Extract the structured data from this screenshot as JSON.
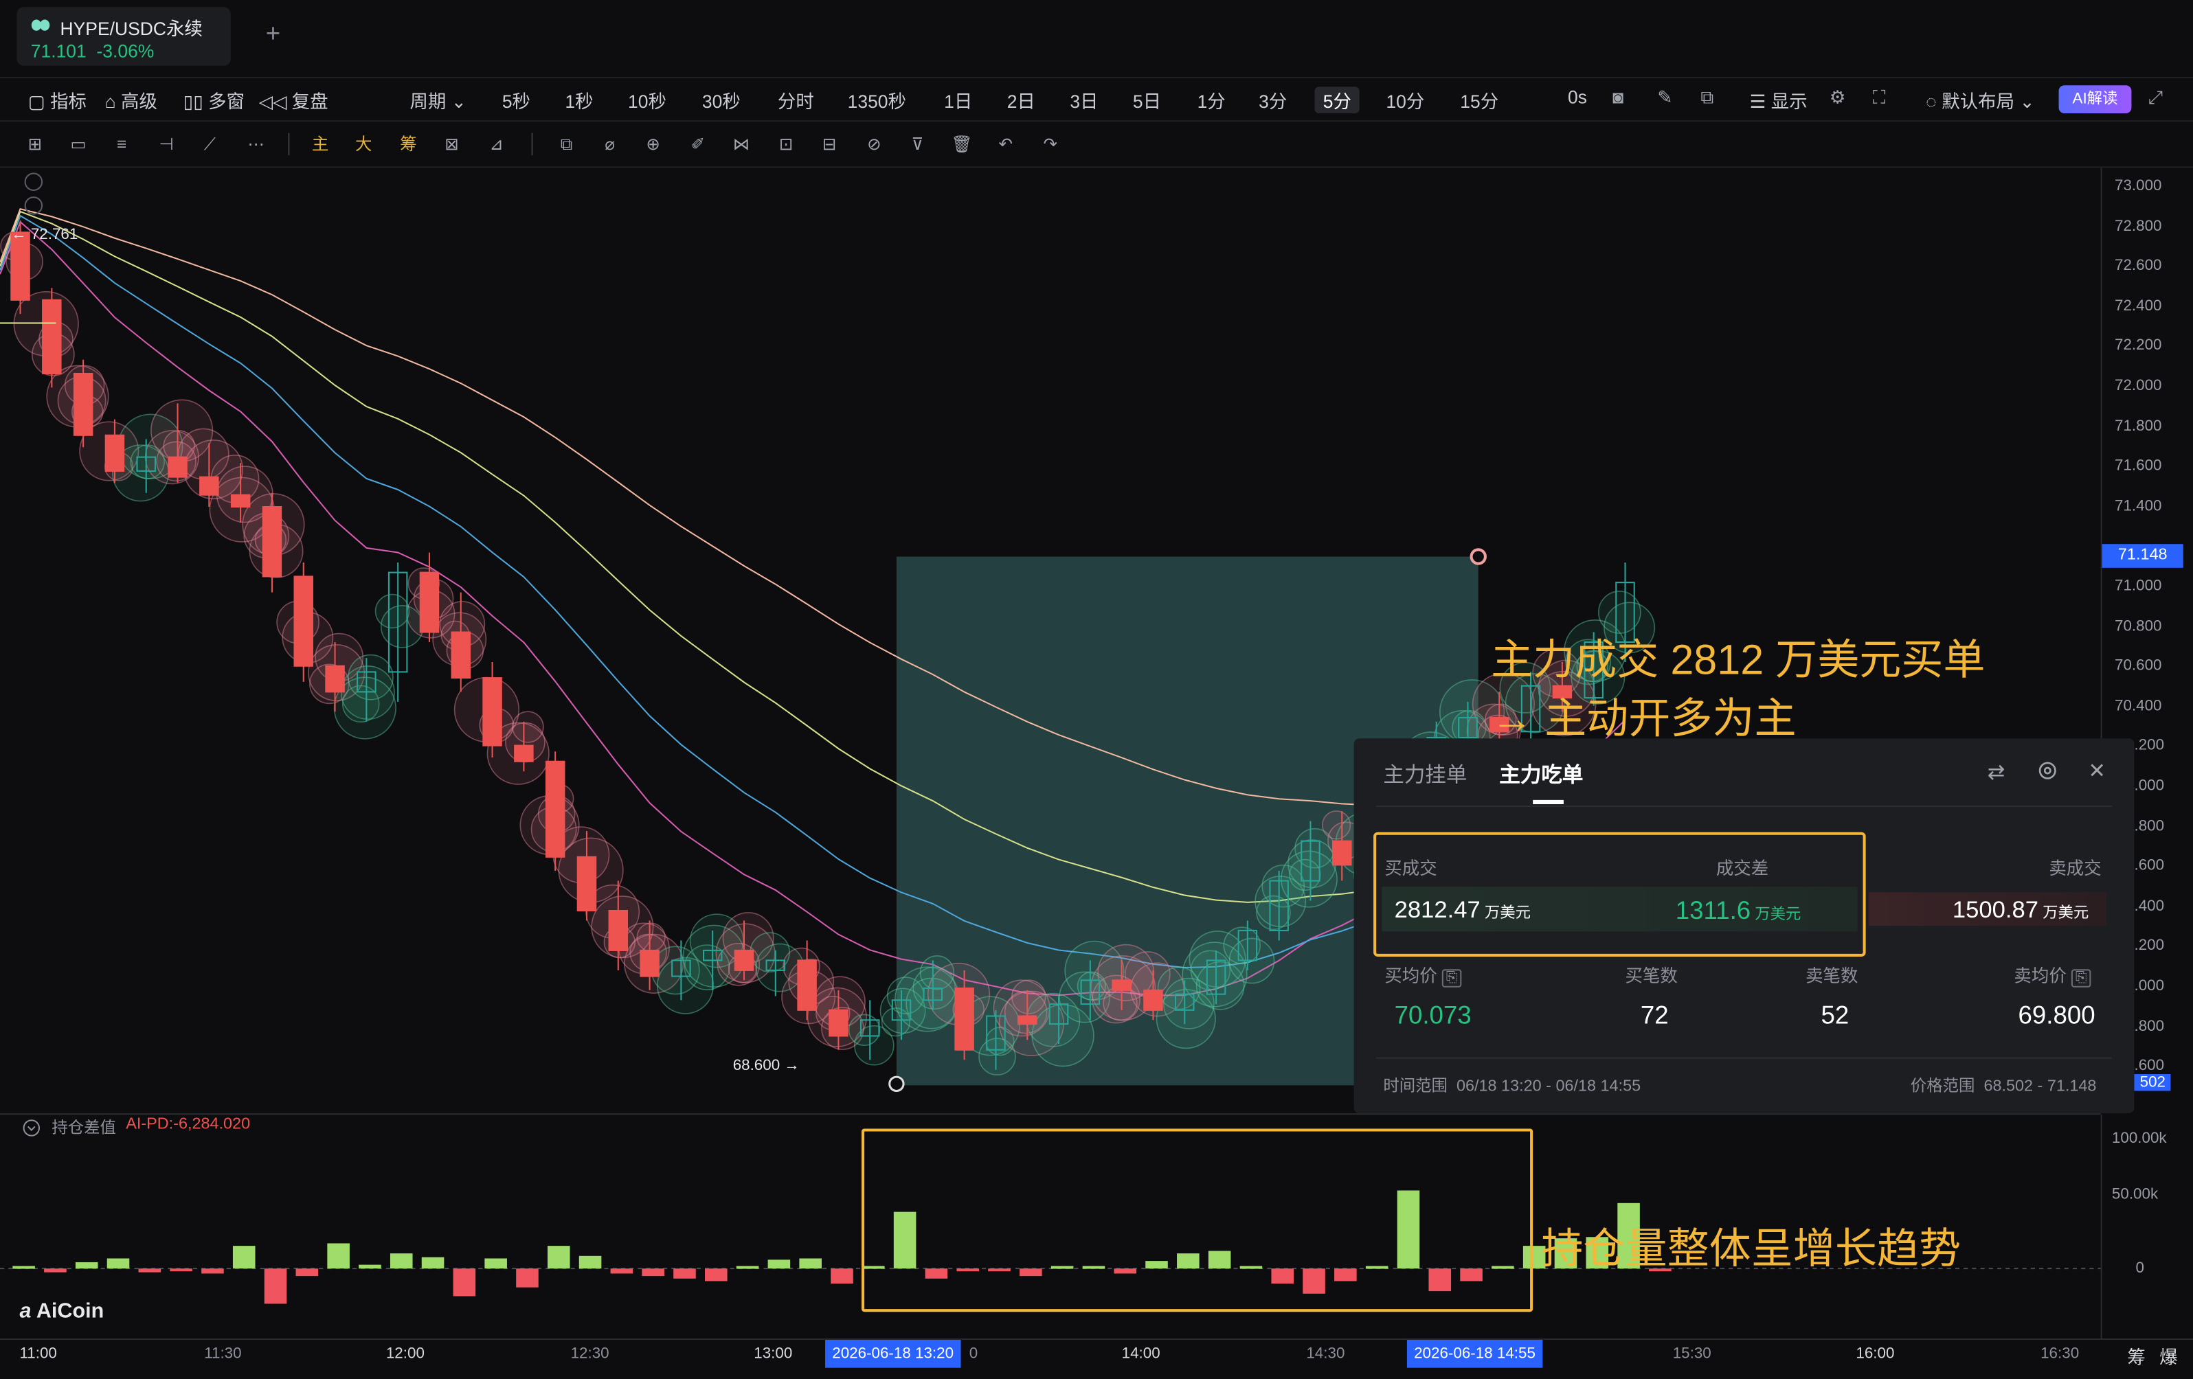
{
  "tab": {
    "title": "HYPE/USDC永续",
    "price": "71.101",
    "change": "-3.06%",
    "plus": "+"
  },
  "toolbar": {
    "items": [
      "指标",
      "高级",
      "多窗",
      "复盘",
      "周期",
      "5秒",
      "1秒",
      "10秒",
      "30秒",
      "分时",
      "1350秒",
      "1日",
      "2日",
      "3日",
      "5日",
      "1分",
      "3分",
      "5分",
      "10分",
      "15分",
      "0s",
      "显示",
      "默认布局",
      "AI解读"
    ]
  },
  "drawbar": {
    "main": "主",
    "big": "大",
    "chip": "筹"
  },
  "chart": {
    "high_label": "← 72.761",
    "low_label": "68.600 →",
    "current_price": "71.148",
    "y_ticks": [
      "73.000",
      "72.800",
      "72.600",
      "72.400",
      "72.200",
      "72.000",
      "71.800",
      "71.600",
      "71.400",
      "71.000",
      "70.800",
      "70.600",
      "70.400",
      ".200",
      ".000",
      ".800",
      ".600",
      ".400",
      ".200",
      ".000",
      ".800",
      ".600"
    ],
    "y_partial_bottom": "502"
  },
  "chart_data": {
    "type": "candlestick",
    "title": "HYPE/USDC永续",
    "interval": "5分",
    "y_range": [
      68.5,
      73.0
    ],
    "colors": {
      "up": "#26a69a",
      "down": "#ef5350",
      "ma1": "#f2b8a0",
      "ma2": "#d6e08a",
      "ma3": "#4ea8de",
      "ma4": "#d65db1"
    },
    "candles": [
      {
        "o": 72.76,
        "h": 72.82,
        "l": 72.35,
        "c": 72.42
      },
      {
        "o": 72.42,
        "h": 72.48,
        "l": 71.98,
        "c": 72.05
      },
      {
        "o": 72.05,
        "h": 72.12,
        "l": 71.68,
        "c": 71.74
      },
      {
        "o": 71.74,
        "h": 71.82,
        "l": 71.5,
        "c": 71.56
      },
      {
        "o": 71.56,
        "h": 71.72,
        "l": 71.45,
        "c": 71.63
      },
      {
        "o": 71.63,
        "h": 71.9,
        "l": 71.5,
        "c": 71.53
      },
      {
        "o": 71.53,
        "h": 71.7,
        "l": 71.38,
        "c": 71.44
      },
      {
        "o": 71.44,
        "h": 71.6,
        "l": 71.3,
        "c": 71.38
      },
      {
        "o": 71.38,
        "h": 71.45,
        "l": 70.95,
        "c": 71.03
      },
      {
        "o": 71.03,
        "h": 71.1,
        "l": 70.5,
        "c": 70.58
      },
      {
        "o": 70.58,
        "h": 70.7,
        "l": 70.35,
        "c": 70.45
      },
      {
        "o": 70.45,
        "h": 70.62,
        "l": 70.3,
        "c": 70.55
      },
      {
        "o": 70.55,
        "h": 71.1,
        "l": 70.4,
        "c": 71.05
      },
      {
        "o": 71.05,
        "h": 71.15,
        "l": 70.7,
        "c": 70.75
      },
      {
        "o": 70.75,
        "h": 70.95,
        "l": 70.45,
        "c": 70.52
      },
      {
        "o": 70.52,
        "h": 70.6,
        "l": 70.12,
        "c": 70.18
      },
      {
        "o": 70.18,
        "h": 70.3,
        "l": 70.05,
        "c": 70.1
      },
      {
        "o": 70.1,
        "h": 70.15,
        "l": 69.55,
        "c": 69.62
      },
      {
        "o": 69.62,
        "h": 69.75,
        "l": 69.3,
        "c": 69.35
      },
      {
        "o": 69.35,
        "h": 69.5,
        "l": 69.05,
        "c": 69.15
      },
      {
        "o": 69.15,
        "h": 69.3,
        "l": 68.95,
        "c": 69.02
      },
      {
        "o": 69.02,
        "h": 69.2,
        "l": 68.9,
        "c": 69.1
      },
      {
        "o": 69.1,
        "h": 69.25,
        "l": 68.95,
        "c": 69.15
      },
      {
        "o": 69.15,
        "h": 69.3,
        "l": 69.0,
        "c": 69.05
      },
      {
        "o": 69.05,
        "h": 69.15,
        "l": 68.92,
        "c": 69.1
      },
      {
        "o": 69.1,
        "h": 69.2,
        "l": 68.8,
        "c": 68.85
      },
      {
        "o": 68.85,
        "h": 68.95,
        "l": 68.65,
        "c": 68.72
      },
      {
        "o": 68.72,
        "h": 68.9,
        "l": 68.6,
        "c": 68.8
      },
      {
        "o": 68.8,
        "h": 68.95,
        "l": 68.7,
        "c": 68.9
      },
      {
        "o": 68.9,
        "h": 69.1,
        "l": 68.85,
        "c": 68.96
      },
      {
        "o": 68.96,
        "h": 69.05,
        "l": 68.6,
        "c": 68.65
      },
      {
        "o": 68.65,
        "h": 68.85,
        "l": 68.55,
        "c": 68.82
      },
      {
        "o": 68.82,
        "h": 68.95,
        "l": 68.7,
        "c": 68.78
      },
      {
        "o": 68.78,
        "h": 68.92,
        "l": 68.68,
        "c": 68.88
      },
      {
        "o": 68.88,
        "h": 69.1,
        "l": 68.8,
        "c": 69.0
      },
      {
        "o": 69.0,
        "h": 69.1,
        "l": 68.85,
        "c": 68.95
      },
      {
        "o": 68.95,
        "h": 69.05,
        "l": 68.8,
        "c": 68.85
      },
      {
        "o": 68.85,
        "h": 69.0,
        "l": 68.78,
        "c": 68.93
      },
      {
        "o": 68.93,
        "h": 69.15,
        "l": 68.88,
        "c": 69.1
      },
      {
        "o": 69.1,
        "h": 69.3,
        "l": 69.05,
        "c": 69.25
      },
      {
        "o": 69.25,
        "h": 69.55,
        "l": 69.2,
        "c": 69.5
      },
      {
        "o": 69.5,
        "h": 69.8,
        "l": 69.4,
        "c": 69.7
      },
      {
        "o": 69.7,
        "h": 69.85,
        "l": 69.5,
        "c": 69.58
      },
      {
        "o": 69.58,
        "h": 69.78,
        "l": 69.45,
        "c": 69.72
      },
      {
        "o": 69.72,
        "h": 70.05,
        "l": 69.65,
        "c": 69.98
      },
      {
        "o": 69.98,
        "h": 70.3,
        "l": 69.9,
        "c": 70.22
      },
      {
        "o": 70.22,
        "h": 70.4,
        "l": 70.1,
        "c": 70.32
      },
      {
        "o": 70.32,
        "h": 70.45,
        "l": 70.2,
        "c": 70.25
      },
      {
        "o": 70.25,
        "h": 70.55,
        "l": 70.18,
        "c": 70.48
      },
      {
        "o": 70.48,
        "h": 70.6,
        "l": 70.35,
        "c": 70.42
      },
      {
        "o": 70.42,
        "h": 70.75,
        "l": 70.38,
        "c": 70.7
      },
      {
        "o": 70.7,
        "h": 71.1,
        "l": 70.6,
        "c": 71.0
      }
    ],
    "annotation_box": {
      "time_range": "06/18 13:20 - 06/18 14:55",
      "price_range": "68.502 - 71.148"
    },
    "x_ticks": [
      "11:00",
      "11:30",
      "12:00",
      "12:30",
      "13:00",
      "2026-06-18 13:20",
      "14:00",
      "14:30",
      "2026-06-18 14:55",
      "15:30",
      "16:00",
      "16:30"
    ],
    "sub_indicator": {
      "name": "持仓差值",
      "ai_pd": "AI-PD:-6,284.020",
      "y_ticks": [
        "100.00k",
        "50.00k",
        "0"
      ],
      "y_range": [
        -50,
        100
      ],
      "values_k": [
        2,
        -3,
        5,
        8,
        -3,
        -2,
        -4,
        18,
        -28,
        -6,
        20,
        3,
        12,
        9,
        -22,
        8,
        -15,
        18,
        10,
        -4,
        -6,
        -8,
        -10,
        2,
        7,
        8,
        -12,
        2,
        45,
        -8,
        -2,
        -2,
        -6,
        2,
        2,
        -4,
        6,
        12,
        14,
        2,
        -12,
        -20,
        -10,
        2,
        62,
        -18,
        -10,
        2,
        18,
        24,
        25,
        52,
        -2
      ]
    }
  },
  "panel": {
    "tab_pending": "主力挂单",
    "tab_taken": "主力吃单",
    "buy_label": "买成交",
    "diff_label": "成交差",
    "sell_label": "卖成交",
    "buy_value": "2812.47",
    "diff_value": "1311.6",
    "sell_value": "1500.87",
    "unit": "万美元",
    "avg_buy_label": "买均价",
    "buy_count_label": "买笔数",
    "sell_count_label": "卖笔数",
    "avg_sell_label": "卖均价",
    "avg_buy": "70.073",
    "buy_count": "72",
    "sell_count": "52",
    "avg_sell": "69.800",
    "time_label": "时间范围",
    "time_value": "06/18 13:20 - 06/18 14:55",
    "price_label": "价格范围",
    "price_value": "68.502 - 71.148"
  },
  "callouts": {
    "line1": "主力成交 2812 万美元买单",
    "line2": "→ 主动开多为主",
    "line3": "持仓量整体呈增长趋势"
  },
  "brand": {
    "logo": "AiCoin",
    "right1": "筹",
    "right2": "爆"
  }
}
